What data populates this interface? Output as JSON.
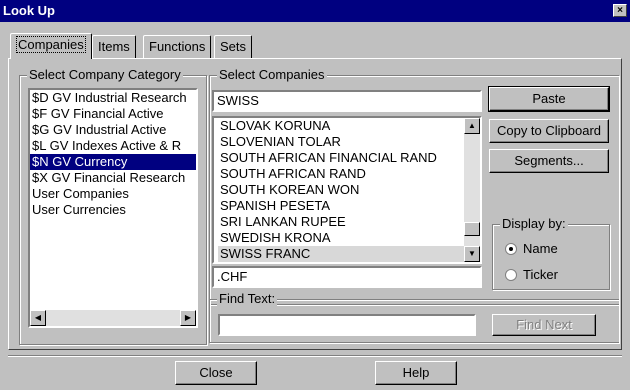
{
  "window": {
    "title": "Look Up",
    "close_glyph": "×"
  },
  "tabs": [
    {
      "label": "Companies",
      "active": true
    },
    {
      "label": "Items"
    },
    {
      "label": "Functions"
    },
    {
      "label": "Sets"
    }
  ],
  "category": {
    "label": "Select Company Category",
    "items": [
      "$D GV Industrial Research",
      "$F GV Financial Active",
      "$G GV Industrial Active",
      "$L GV Indexes Active & R",
      "$N GV Currency",
      "$X GV Financial Research",
      "User Companies",
      "User Currencies"
    ],
    "selected_index": 4
  },
  "companies": {
    "label": "Select Companies",
    "search_value": "SWISS",
    "items": [
      "SLOVAK KORUNA",
      "SLOVENIAN TOLAR",
      "SOUTH AFRICAN FINANCIAL RAND",
      "SOUTH AFRICAN RAND",
      "SOUTH KOREAN WON",
      "SPANISH PESETA",
      "SRI LANKAN RUPEE",
      "SWEDISH KRONA",
      "SWISS FRANC"
    ],
    "selected": "SWISS FRANC",
    "code": ".CHF"
  },
  "buttons": {
    "paste_label": "Paste",
    "copy_label": "Copy to Clipboard",
    "segments_label": "Segments...",
    "find_next_label": "Find Next",
    "close_label": "Close",
    "help_label": "Help"
  },
  "display_by": {
    "label": "Display by:",
    "options": [
      "Name",
      "Ticker"
    ],
    "selected": "Name"
  },
  "find": {
    "label": "Find Text:",
    "value": ""
  }
}
